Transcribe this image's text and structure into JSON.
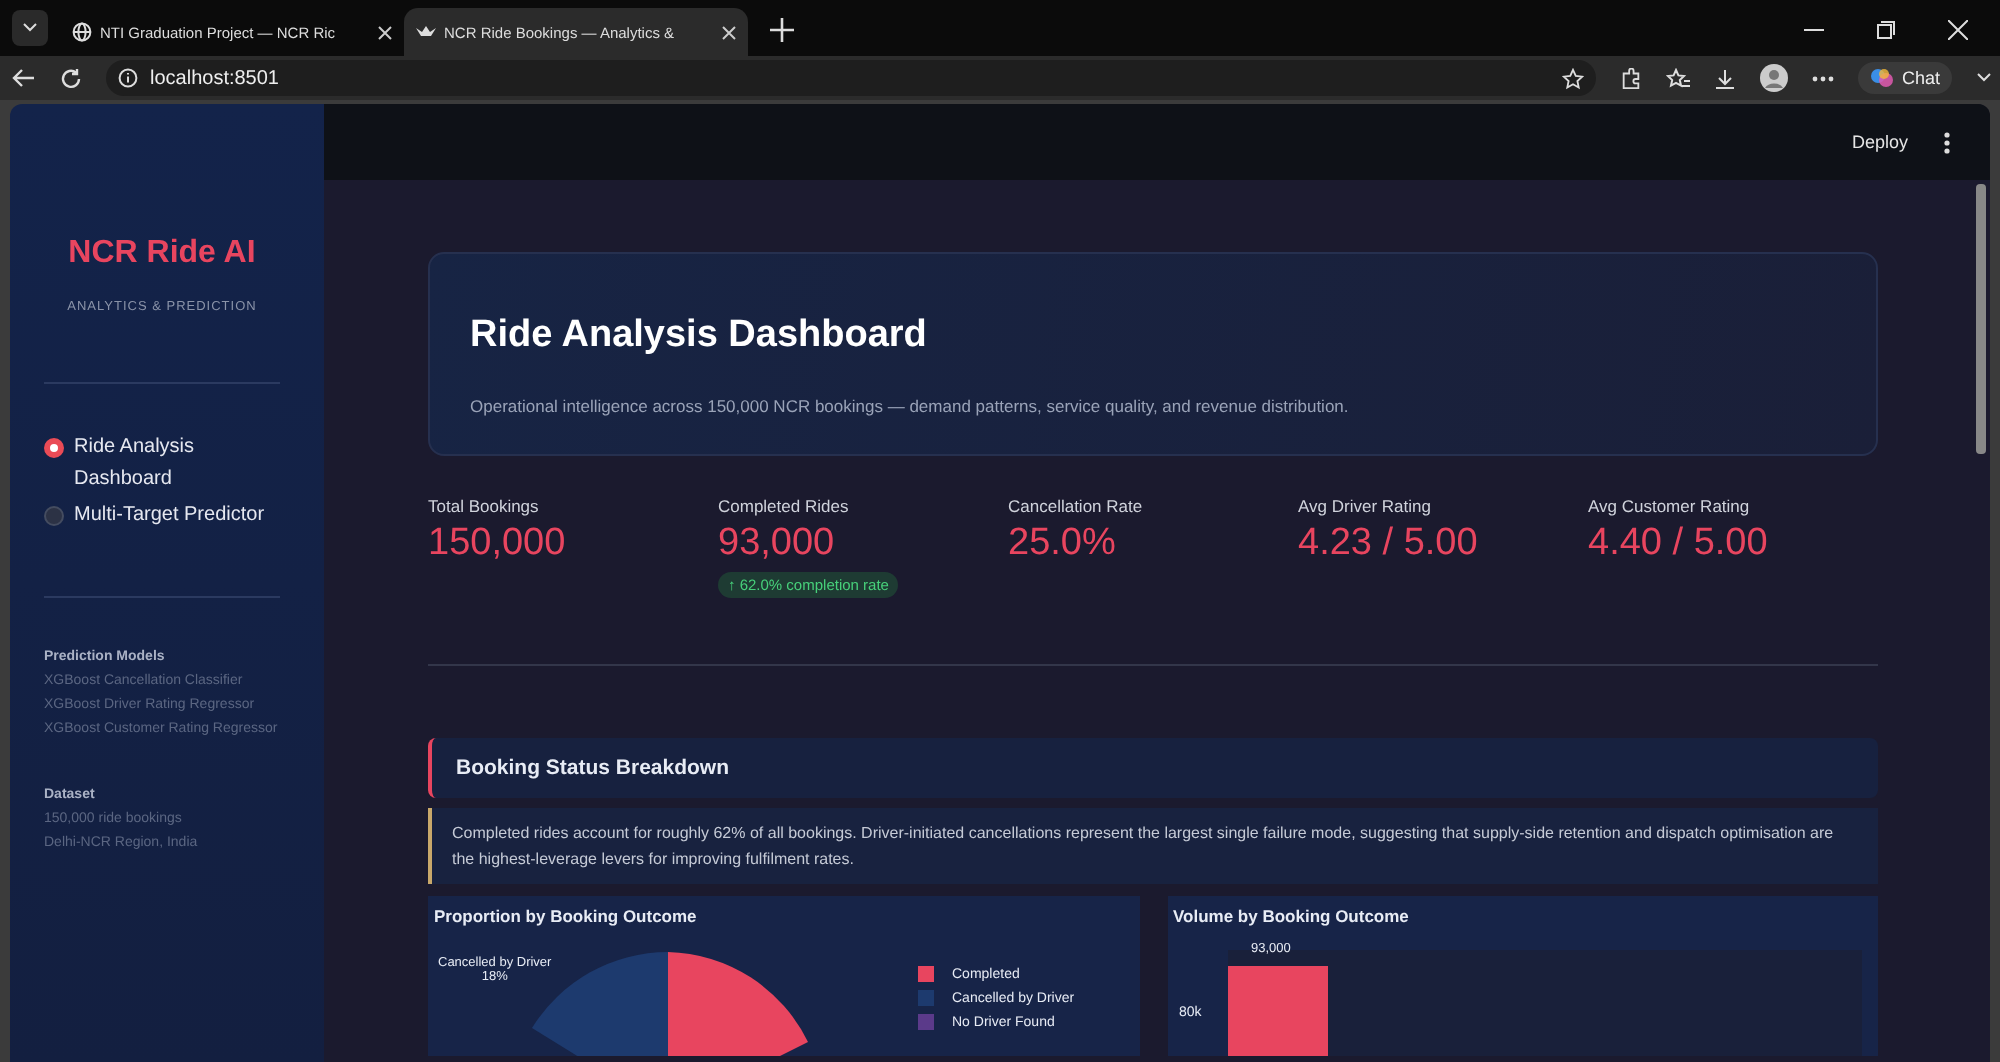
{
  "browser": {
    "tabs": [
      {
        "title": "NTI Graduation Project — NCR Ric",
        "selected": false
      },
      {
        "title": "NCR Ride Bookings — Analytics &",
        "selected": true
      }
    ],
    "address": "localhost:8501",
    "chat_label": "Chat"
  },
  "sidebar": {
    "brand": "NCR Ride AI",
    "tagline": "ANALYTICS & PREDICTION",
    "nav": [
      {
        "label": "Ride Analysis Dashboard",
        "selected": true
      },
      {
        "label": "Multi-Target Predictor",
        "selected": false
      }
    ],
    "sections": [
      {
        "heading": "Prediction Models",
        "items": [
          "XGBoost Cancellation Classifier",
          "XGBoost Driver Rating Regressor",
          "XGBoost Customer Rating Regressor"
        ]
      },
      {
        "heading": "Dataset",
        "items": [
          "150,000 ride bookings",
          "Delhi-NCR Region, India"
        ]
      }
    ]
  },
  "header": {
    "deploy": "Deploy"
  },
  "hero": {
    "title": "Ride Analysis Dashboard",
    "subtitle": "Operational intelligence across 150,000 NCR bookings — demand patterns, service quality, and revenue distribution."
  },
  "metrics": [
    {
      "label": "Total Bookings",
      "value": "150,000"
    },
    {
      "label": "Completed Rides",
      "value": "93,000",
      "delta": "↑ 62.0% completion rate"
    },
    {
      "label": "Cancellation Rate",
      "value": "25.0%"
    },
    {
      "label": "Avg Driver Rating",
      "value": "4.23 / 5.00"
    },
    {
      "label": "Avg Customer Rating",
      "value": "4.40 / 5.00"
    }
  ],
  "section": {
    "title": "Booking Status Breakdown",
    "note": "Completed rides account for roughly 62% of all bookings. Driver-initiated cancellations represent the largest single failure mode, suggesting that supply-side retention and dispatch optimisation are the highest-leverage levers for improving fulfilment rates."
  },
  "pie_panel": {
    "title": "Proportion by Booking Outcome",
    "slice_label": "Cancelled by Driver",
    "slice_share": "18%",
    "legend": [
      {
        "label": "Completed",
        "color": "#e8455f"
      },
      {
        "label": "Cancelled by Driver",
        "color": "#1d3a6e"
      },
      {
        "label": "No Driver Found",
        "color": "#5b3a8a"
      }
    ]
  },
  "bar_panel": {
    "title": "Volume by Booking Outcome",
    "bar_label": "93,000",
    "axis_tick": "80k"
  }
}
